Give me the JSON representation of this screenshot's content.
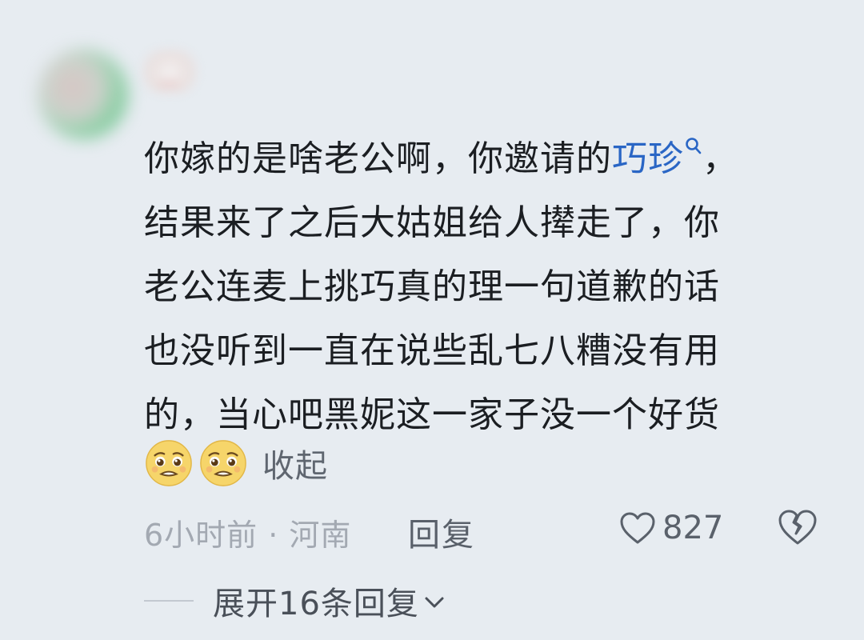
{
  "comment": {
    "text_before_link": "你嫁的是啥老公啊，你邀请的",
    "topic_link": "巧珍",
    "text_after_link": "，\n结果来了之后大姑姐给人撵走了，你\n老公连麦上挑巧真的理一句道歉的话\n也没听到一直在说些乱七八糟没有用\n的，当心吧黑妮这一家子没一个好货",
    "link_color": "#2a66c5",
    "collapse_label": "收起",
    "emojis": [
      "pleading-face-icon",
      "pleading-face-icon"
    ]
  },
  "meta": {
    "time_location": "6小时前 · 河南",
    "reply_label": "回复",
    "likes": "827"
  },
  "replies": {
    "expand_label": "展开16条回复"
  }
}
